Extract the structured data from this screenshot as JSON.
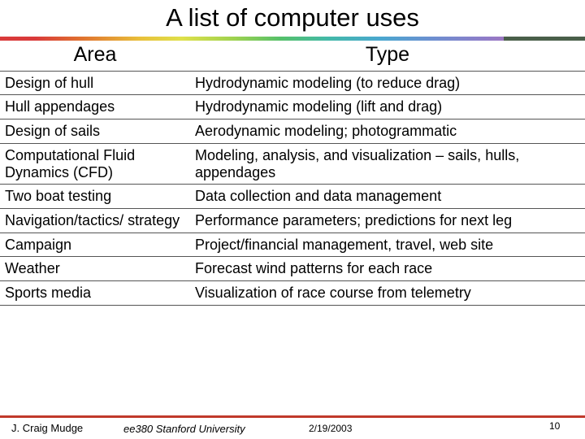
{
  "slide": {
    "title": "A list of computer uses",
    "table": {
      "headers": [
        "Area",
        "Type"
      ],
      "rows": [
        [
          "Design of hull",
          "Hydrodynamic modeling (to reduce drag)"
        ],
        [
          "Hull appendages",
          "Hydrodynamic modeling (lift and drag)"
        ],
        [
          "Design of sails",
          "Aerodynamic modeling; photogrammatic"
        ],
        [
          "Computational Fluid Dynamics (CFD)",
          "Modeling, analysis, and visualization – sails, hulls, appendages"
        ],
        [
          "Two boat testing",
          "Data collection and data management"
        ],
        [
          "Navigation/tactics/ strategy",
          "Performance parameters; predictions for next leg"
        ],
        [
          "Campaign",
          "Project/financial management, travel, web site"
        ],
        [
          "Weather",
          "Forecast wind patterns for each race"
        ],
        [
          "Sports media",
          "Visualization of race course from telemetry"
        ]
      ]
    },
    "footer": {
      "author": "J. Craig Mudge",
      "course": "ee380 Stanford University",
      "date": "2/19/2003",
      "page": "10"
    }
  }
}
